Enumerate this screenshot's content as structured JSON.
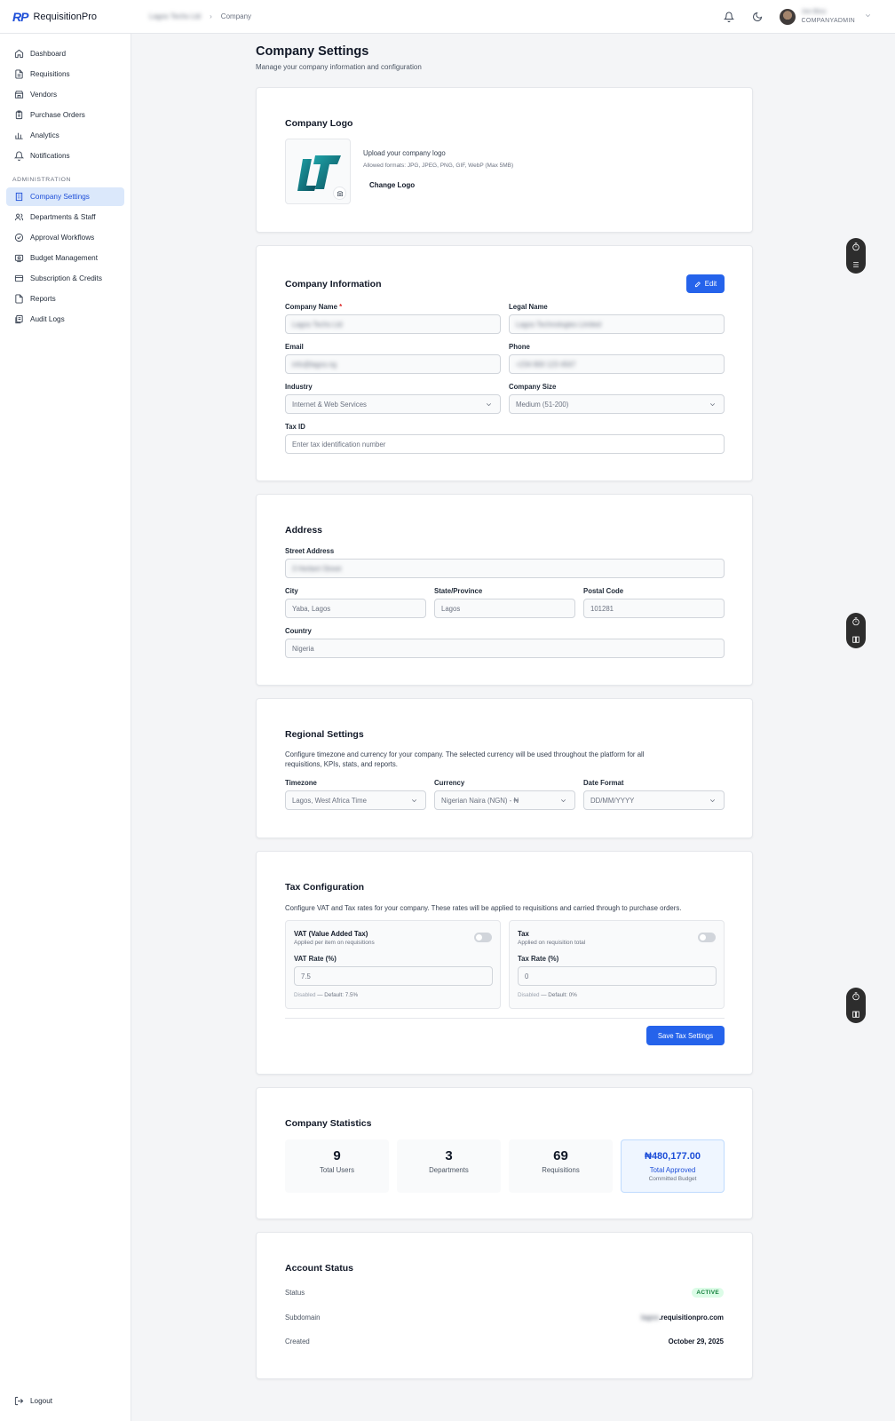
{
  "app": {
    "name": "RequisitionPro",
    "logo_text": "RP"
  },
  "breadcrumb": {
    "company": "Lagos Techs Ltd",
    "current": "Company"
  },
  "user": {
    "name": "Joe Bliss",
    "role": "COMPANYADMIN"
  },
  "sidebar": {
    "items": [
      {
        "label": "Dashboard",
        "icon": "home-icon"
      },
      {
        "label": "Requisitions",
        "icon": "file-icon"
      },
      {
        "label": "Vendors",
        "icon": "store-icon"
      },
      {
        "label": "Purchase Orders",
        "icon": "clipboard-icon"
      },
      {
        "label": "Analytics",
        "icon": "bar-chart-icon"
      },
      {
        "label": "Notifications",
        "icon": "bell-icon"
      }
    ],
    "admin_title": "ADMINISTRATION",
    "admin_items": [
      {
        "label": "Company Settings",
        "icon": "building-icon",
        "active": true
      },
      {
        "label": "Departments & Staff",
        "icon": "users-icon"
      },
      {
        "label": "Approval Workflows",
        "icon": "workflow-icon"
      },
      {
        "label": "Budget Management",
        "icon": "budget-icon"
      },
      {
        "label": "Subscription & Credits",
        "icon": "credit-card-icon"
      },
      {
        "label": "Reports",
        "icon": "report-icon"
      },
      {
        "label": "Audit Logs",
        "icon": "audit-icon"
      }
    ],
    "logout": "Logout"
  },
  "page": {
    "title": "Company Settings",
    "subtitle": "Manage your company information and configuration"
  },
  "logo_card": {
    "title": "Company Logo",
    "upload_title": "Upload your company logo",
    "formats": "Allowed formats: JPG, JPEG, PNG, GIF, WebP (Max 5MB)",
    "change": "Change Logo"
  },
  "info_card": {
    "title": "Company Information",
    "edit": "Edit",
    "company_name_label": "Company Name",
    "company_name": "Lagos Techs Ltd",
    "legal_name_label": "Legal Name",
    "legal_name": "Lagos Technologies Limited",
    "email_label": "Email",
    "email": "info@lagos.ng",
    "phone_label": "Phone",
    "phone": "+234 800 123 4567",
    "industry_label": "Industry",
    "industry": "Internet & Web Services",
    "size_label": "Company Size",
    "size": "Medium (51-200)",
    "tax_label": "Tax ID",
    "tax_placeholder": "Enter tax identification number"
  },
  "address_card": {
    "title": "Address",
    "street_label": "Street Address",
    "street": "3 Herbert Street",
    "city_label": "City",
    "city": "Yaba, Lagos",
    "state_label": "State/Province",
    "state": "Lagos",
    "postal_label": "Postal Code",
    "postal": "101281",
    "country_label": "Country",
    "country": "Nigeria"
  },
  "regional_card": {
    "title": "Regional Settings",
    "desc_line1": "Configure timezone and currency for your company. The selected currency will be used throughout the platform for all",
    "desc_line2": "requisitions, KPIs, stats, and reports.",
    "timezone_label": "Timezone",
    "timezone": "Lagos, West Africa Time",
    "currency_label": "Currency",
    "currency": "Nigerian Naira (NGN) - ₦",
    "date_label": "Date Format",
    "date_format": "DD/MM/YYYY"
  },
  "tax_card": {
    "title": "Tax Configuration",
    "desc": "Configure VAT and Tax rates for your company. These rates will be applied to requisitions and carried through to purchase orders.",
    "vat_title": "VAT (Value Added Tax)",
    "vat_sub": "Applied per item on requisitions",
    "vat_rate_label": "VAT Rate (%)",
    "vat_rate": "7.5",
    "vat_note_status": "Disabled",
    "vat_note_default": "— Default: 7.5%",
    "tax_title": "Tax",
    "tax_sub": "Applied on requisition total",
    "tax_rate_label": "Tax Rate (%)",
    "tax_rate": "0",
    "tax_note_status": "Disabled",
    "tax_note_default": "— Default: 0%",
    "vat_enabled": false,
    "tax_enabled": false,
    "save": "Save Tax Settings"
  },
  "stats_card": {
    "title": "Company Statistics",
    "users": "9",
    "users_label": "Total Users",
    "departments": "3",
    "departments_label": "Departments",
    "requisitions": "69",
    "requisitions_label": "Requisitions",
    "approved": "₦480,177.00",
    "approved_label": "Total Approved",
    "approved_sub": "Committed Budget"
  },
  "account_card": {
    "title": "Account Status",
    "status_label": "Status",
    "status": "ACTIVE",
    "subdomain_label": "Subdomain",
    "subdomain_prefix": "lagos",
    "subdomain_suffix": ".requisitionpro.com",
    "created_label": "Created",
    "created": "October 29, 2025"
  },
  "colors": {
    "accent": "#2563eb",
    "active_bg": "#dbe8fb",
    "success": "#15803d"
  }
}
